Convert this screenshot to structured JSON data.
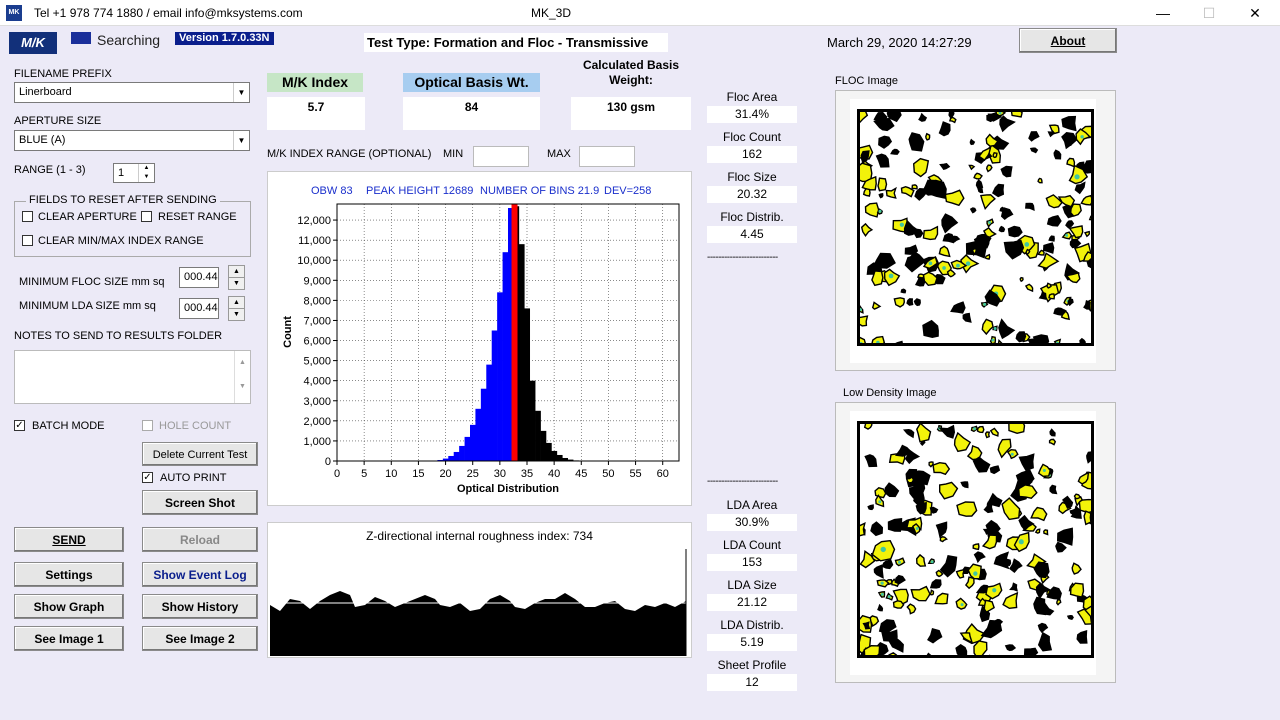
{
  "titlebar": {
    "contact": "Tel +1 978 774 1880 / email info@mksystems.com",
    "title": "MK_3D",
    "app_icon_text": "MK"
  },
  "header": {
    "logo": "M/K",
    "status": "Searching",
    "version": "Version 1.7.0.33N",
    "test_type": "Test Type: Formation and Floc - Transmissive",
    "datetime": "March 29, 2020 14:27:29",
    "about": "About"
  },
  "left": {
    "filename_label": "FILENAME PREFIX",
    "filename_value": "Linerboard",
    "aperture_label": "APERTURE SIZE",
    "aperture_value": "BLUE (A)",
    "range_label": "RANGE  (1 - 3)",
    "range_value": "1",
    "fields_title": "FIELDS TO RESET AFTER SENDING",
    "clear_aperture": "CLEAR APERTURE",
    "reset_range": "RESET RANGE",
    "clear_minmax": "CLEAR MIN/MAX INDEX RANGE",
    "min_floc_label": "MINIMUM FLOC SIZE mm sq",
    "min_floc_value": "000.44",
    "min_lda_label": "MINIMUM LDA SIZE mm sq",
    "min_lda_value": "000.44",
    "notes_label": "NOTES TO SEND TO RESULTS FOLDER",
    "batch_mode": "BATCH MODE",
    "hole_count": "HOLE COUNT",
    "auto_print": "AUTO PRINT"
  },
  "buttons": {
    "delete": "Delete Current Test",
    "screenshot": "Screen Shot",
    "send": "SEND",
    "reload": "Reload",
    "settings": "Settings",
    "show_event_log": "Show Event Log",
    "show_graph": "Show Graph",
    "show_history": "Show History",
    "see_image1": "See Image 1",
    "see_image2": "See Image 2"
  },
  "metrics": {
    "mk_label": "M/K Index",
    "mk_value": "5.7",
    "obw_label": "Optical Basis Wt.",
    "obw_value": "84",
    "cbw_label": "Calculated Basis Weight:",
    "cbw_value": "130 gsm"
  },
  "range": {
    "label": "M/K INDEX RANGE (OPTIONAL)",
    "min": "MIN",
    "max": "MAX"
  },
  "floc_stats": [
    {
      "label": "Floc Area",
      "value": "31.4%"
    },
    {
      "label": "Floc Count",
      "value": "162"
    },
    {
      "label": "Floc Size",
      "value": "20.32"
    },
    {
      "label": "Floc Distrib.",
      "value": "4.45"
    }
  ],
  "lda_stats": [
    {
      "label": "LDA Area",
      "value": "30.9%"
    },
    {
      "label": "LDA Count",
      "value": "153"
    },
    {
      "label": "LDA Size",
      "value": "21.12"
    },
    {
      "label": "LDA Distrib.",
      "value": "5.19"
    },
    {
      "label": "Sheet Profile",
      "value": "12"
    }
  ],
  "dashes": "-------------------------",
  "images": {
    "floc_title": "FLOC Image",
    "lda_title": "Low Density Image"
  },
  "roughness": {
    "title": "Z-directional internal roughness index: 734"
  },
  "chart_data": {
    "type": "bar",
    "header": [
      "OBW 83",
      "PEAK HEIGHT 12689",
      "NUMBER OF BINS 21.9",
      "DEV=258"
    ],
    "xlabel": "Optical Distribution",
    "ylabel": "Count",
    "xlim": [
      0,
      63
    ],
    "ylim": [
      0,
      12800
    ],
    "xticks": [
      0,
      5,
      10,
      15,
      20,
      25,
      30,
      35,
      40,
      45,
      50,
      55,
      60
    ],
    "yticks": [
      0,
      1000,
      2000,
      3000,
      4000,
      5000,
      6000,
      7000,
      8000,
      9000,
      10000,
      11000,
      12000
    ],
    "ytick_labels": [
      "0",
      "1,000",
      "2,000",
      "3,000",
      "4,000",
      "5,000",
      "6,000",
      "7,000",
      "8,000",
      "9,000",
      "10,000",
      "11,000",
      "12,000"
    ],
    "grid": true,
    "marker_x": 32.7,
    "colors": {
      "left": "#0000FF",
      "right": "#000000",
      "marker": "#FF0000"
    },
    "bins": [
      [
        18,
        20
      ],
      [
        19,
        50
      ],
      [
        20,
        120
      ],
      [
        21,
        250
      ],
      [
        22,
        450
      ],
      [
        23,
        750
      ],
      [
        24,
        1200
      ],
      [
        25,
        1800
      ],
      [
        26,
        2600
      ],
      [
        27,
        3600
      ],
      [
        28,
        4800
      ],
      [
        29,
        6500
      ],
      [
        30,
        8400
      ],
      [
        31,
        10400
      ],
      [
        32,
        12600
      ],
      [
        33,
        12689
      ],
      [
        34,
        10800
      ],
      [
        35,
        7600
      ],
      [
        36,
        4000
      ],
      [
        37,
        2500
      ],
      [
        38,
        1500
      ],
      [
        39,
        900
      ],
      [
        40,
        500
      ],
      [
        41,
        300
      ],
      [
        42,
        150
      ],
      [
        43,
        70
      ],
      [
        44,
        30
      ],
      [
        45,
        10
      ]
    ]
  }
}
